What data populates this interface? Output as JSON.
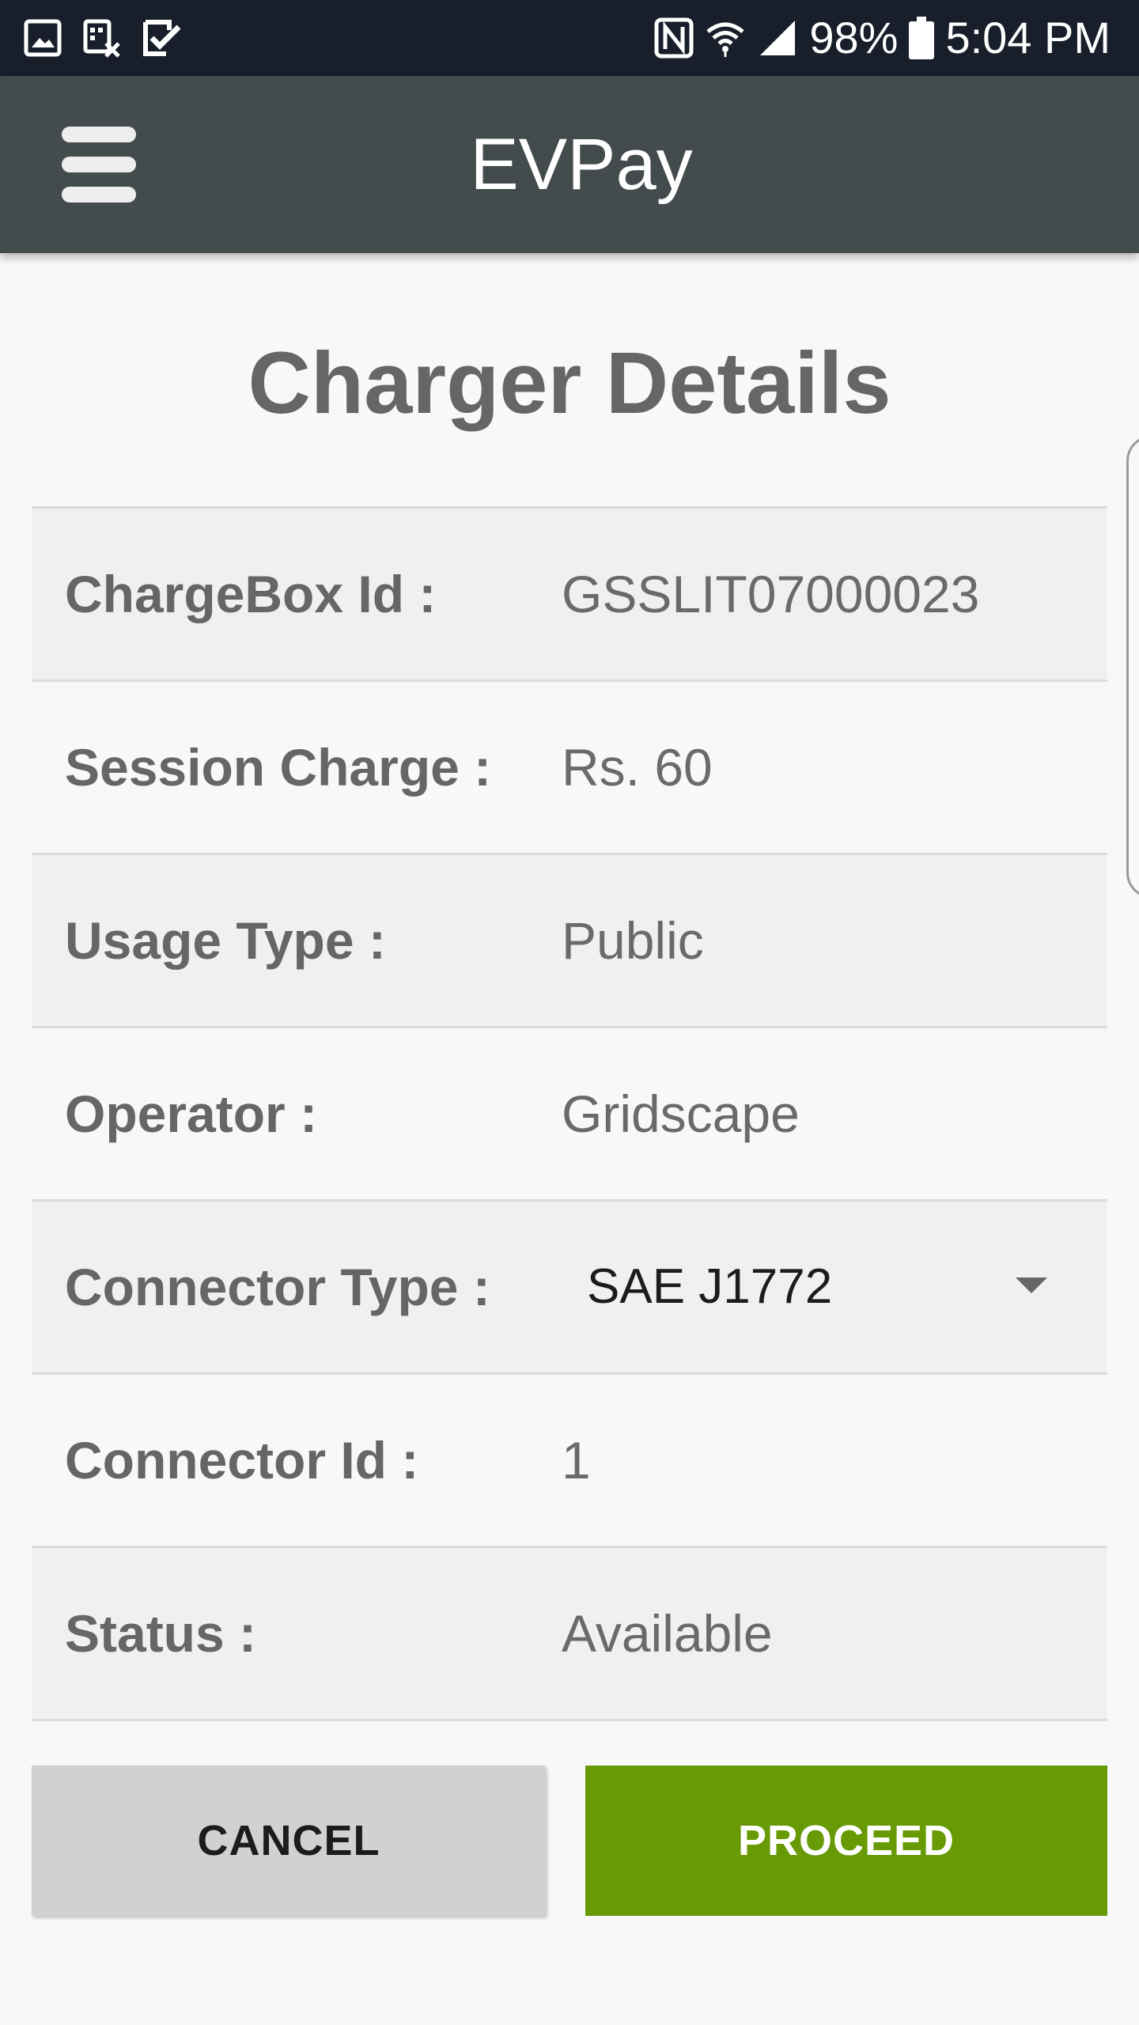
{
  "status_bar": {
    "icons_left": [
      "gallery-icon",
      "screenshot-icon",
      "task-check-icon"
    ],
    "icons_right": [
      "nfc-icon",
      "wifi-icon",
      "cell-signal-icon",
      "battery-icon"
    ],
    "battery_percent": "98%",
    "time": "5:04 PM"
  },
  "app_bar": {
    "title": "EVPay",
    "menu_icon": "hamburger-menu-icon"
  },
  "page": {
    "title": "Charger Details"
  },
  "details": {
    "chargebox_label": "ChargeBox Id :",
    "chargebox_value": "GSSLIT07000023",
    "session_charge_label": "Session Charge :",
    "session_charge_value": "Rs. 60",
    "usage_type_label": "Usage Type :",
    "usage_type_value": "Public",
    "operator_label": "Operator :",
    "operator_value": "Gridscape",
    "connector_type_label": "Connector Type :",
    "connector_type_selected": "SAE J1772",
    "connector_id_label": "Connector Id :",
    "connector_id_value": "1",
    "status_label": "Status :",
    "status_value": "Available"
  },
  "actions": {
    "cancel_label": "CANCEL",
    "proceed_label": "PROCEED"
  },
  "colors": {
    "status_bar": "#181f2b",
    "app_bar": "#434b4c",
    "proceed": "#679a05",
    "cancel": "#d1d1d1",
    "row_shade": "#f0f0f0"
  }
}
